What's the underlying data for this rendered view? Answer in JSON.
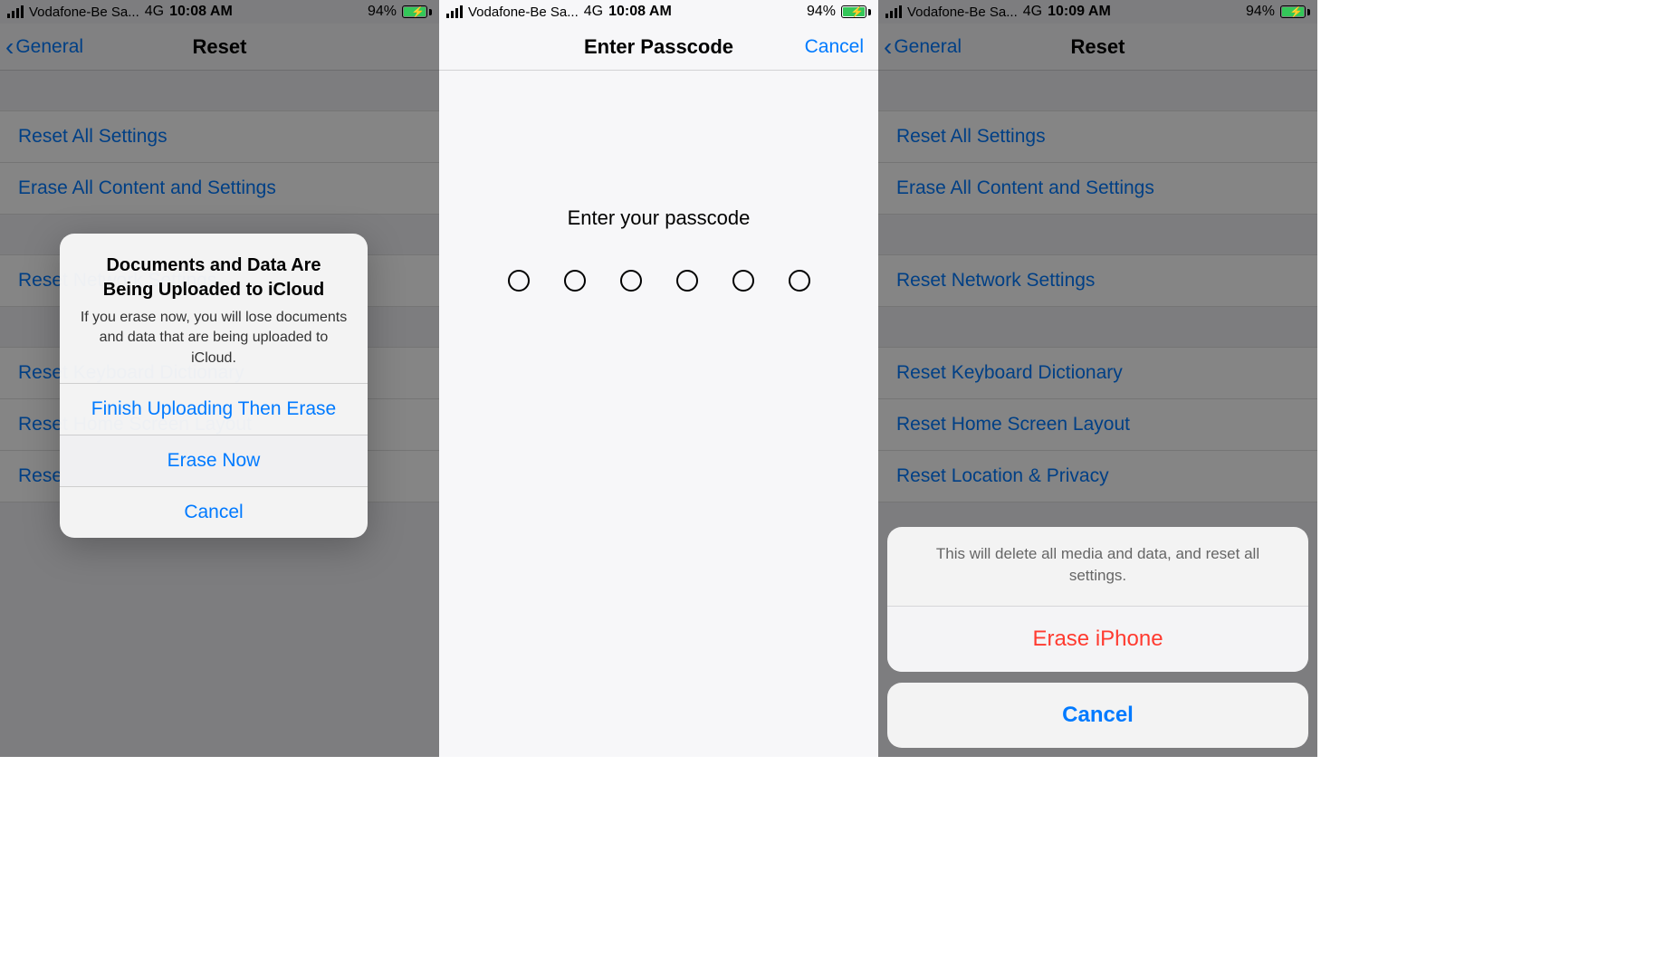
{
  "status": {
    "carrier": "Vodafone-Be Sa...",
    "network": "4G",
    "time_a": "10:08 AM",
    "time_b": "10:09 AM",
    "battery": "94%"
  },
  "reset_screen": {
    "back_label": "General",
    "title": "Reset",
    "items": {
      "reset_all": "Reset All Settings",
      "erase_all": "Erase All Content and Settings",
      "reset_network": "Reset Network Settings",
      "reset_keyboard": "Reset Keyboard Dictionary",
      "reset_home": "Reset Home Screen Layout",
      "reset_location": "Reset Location & Privacy"
    }
  },
  "alert": {
    "title": "Documents and Data Are Being Uploaded to iCloud",
    "body": "If you erase now, you will lose documents and data that are being uploaded to iCloud.",
    "finish": "Finish Uploading Then Erase",
    "erase_now": "Erase Now",
    "cancel": "Cancel"
  },
  "passcode": {
    "title": "Enter Passcode",
    "cancel": "Cancel",
    "prompt": "Enter your passcode"
  },
  "sheet": {
    "message": "This will delete all media and data, and reset all settings.",
    "erase": "Erase iPhone",
    "cancel": "Cancel"
  }
}
